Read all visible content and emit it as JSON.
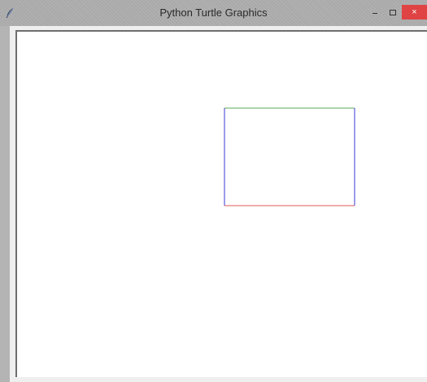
{
  "window": {
    "title": "Python Turtle Graphics",
    "close_symbol": "×",
    "icons": {
      "app": "feather-icon",
      "minimize": "minimize-icon",
      "maximize": "maximize-icon",
      "close": "close-icon"
    }
  },
  "drawing": {
    "shape": "rectangle",
    "edges": [
      {
        "side": "top",
        "color": "#5aa85a"
      },
      {
        "side": "right",
        "color": "#3a3ad8"
      },
      {
        "side": "bottom",
        "color": "#e05a5a"
      },
      {
        "side": "left",
        "color": "#3a3ad8"
      }
    ]
  },
  "colors": {
    "titlebar": "#b0b0b0",
    "close_button": "#e04343",
    "canvas": "#ffffff"
  }
}
